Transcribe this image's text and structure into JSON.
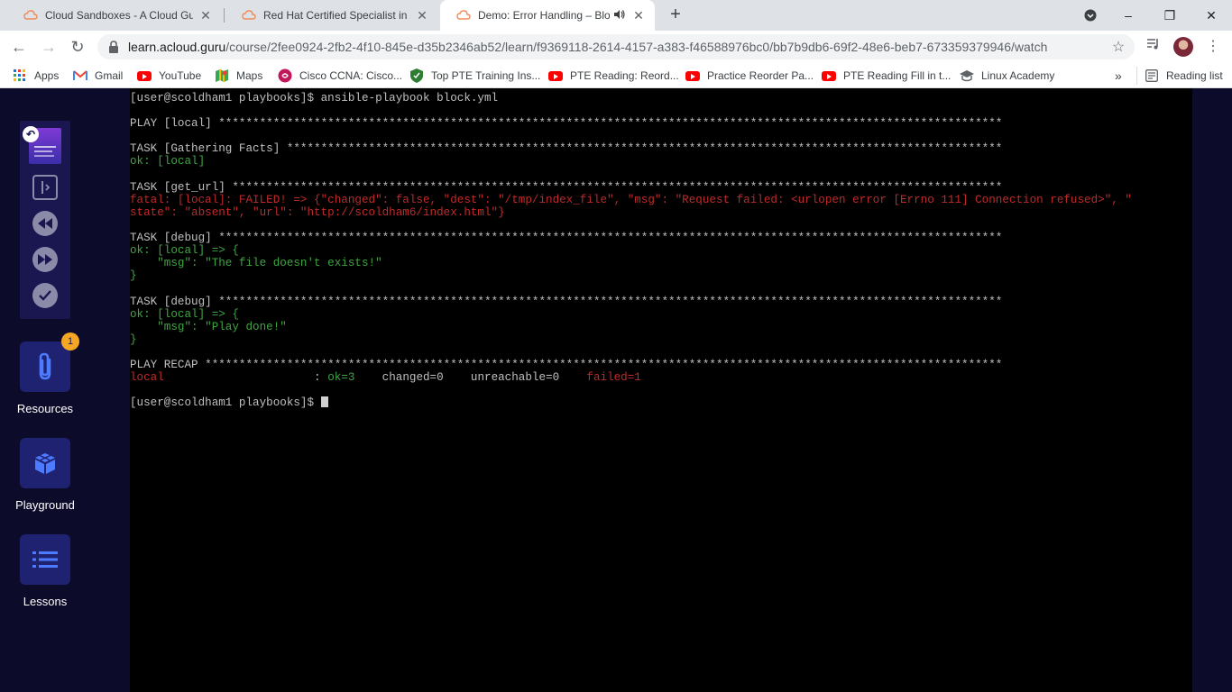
{
  "browser": {
    "tabs": [
      {
        "title": "Cloud Sandboxes - A Cloud Guru",
        "active": false
      },
      {
        "title": "Red Hat Certified Specialist in An",
        "active": false
      },
      {
        "title": "Demo: Error Handling – Block",
        "active": true
      }
    ],
    "new_tab": "+",
    "window_controls": {
      "minimize": "–",
      "restore": "❐",
      "close": "✕"
    },
    "url_host": "learn.acloud.guru",
    "url_path": "/course/2fee0924-2fb2-4f10-845e-d35b2346ab52/learn/f9369118-2614-4157-a383-f46588976bc0/bb7b9db6-69f2-48e6-beb7-673359379946/watch",
    "bookmarks": [
      {
        "label": "Apps",
        "icon": "apps-grid-icon"
      },
      {
        "label": "Gmail",
        "icon": "gmail-icon"
      },
      {
        "label": "YouTube",
        "icon": "youtube-icon"
      },
      {
        "label": "Maps",
        "icon": "maps-icon"
      },
      {
        "label": "Cisco CCNA: Cisco...",
        "icon": "cisco-icon"
      },
      {
        "label": "Top PTE Training Ins...",
        "icon": "shield-icon"
      },
      {
        "label": "PTE Reading: Reord...",
        "icon": "youtube-icon"
      },
      {
        "label": "Practice Reorder Pa...",
        "icon": "youtube-icon"
      },
      {
        "label": "PTE Reading Fill in t...",
        "icon": "youtube-icon"
      },
      {
        "label": "Linux Academy",
        "icon": "graduation-cap-icon"
      }
    ],
    "bookmarks_overflow": "»",
    "reading_list": "Reading list"
  },
  "sidebar": {
    "resources_label": "Resources",
    "resources_badge": "1",
    "playground_label": "Playground",
    "lessons_label": "Lessons"
  },
  "terminal": {
    "lines": [
      {
        "segments": [
          {
            "text": "[user@scoldham1 playbooks]$ ansible-playbook block.yml",
            "color": "w"
          }
        ]
      },
      {
        "segments": [
          {
            "text": " ",
            "color": "w"
          }
        ]
      },
      {
        "segments": [
          {
            "text": "PLAY [local] *******************************************************************************************************************",
            "color": "w"
          }
        ]
      },
      {
        "segments": [
          {
            "text": " ",
            "color": "w"
          }
        ]
      },
      {
        "segments": [
          {
            "text": "TASK [Gathering Facts] *********************************************************************************************************",
            "color": "w"
          }
        ]
      },
      {
        "segments": [
          {
            "text": "ok: [local]",
            "color": "g"
          }
        ]
      },
      {
        "segments": [
          {
            "text": " ",
            "color": "w"
          }
        ]
      },
      {
        "segments": [
          {
            "text": "TASK [get_url] *****************************************************************************************************************",
            "color": "w"
          }
        ]
      },
      {
        "segments": [
          {
            "text": "fatal: [local]: FAILED! => {\"changed\": false, \"dest\": \"/tmp/index_file\", \"msg\": \"Request failed: <urlopen error [Errno 111] Connection refused>\", \"",
            "color": "r"
          }
        ]
      },
      {
        "segments": [
          {
            "text": "state\": \"absent\", \"url\": \"http://scoldham6/index.html\"}",
            "color": "r"
          }
        ]
      },
      {
        "segments": [
          {
            "text": " ",
            "color": "w"
          }
        ]
      },
      {
        "segments": [
          {
            "text": "TASK [debug] *******************************************************************************************************************",
            "color": "w"
          }
        ]
      },
      {
        "segments": [
          {
            "text": "ok: [local] => {",
            "color": "g"
          }
        ]
      },
      {
        "segments": [
          {
            "text": "    \"msg\": \"The file doesn't exists!\"",
            "color": "g"
          }
        ]
      },
      {
        "segments": [
          {
            "text": "}",
            "color": "g"
          }
        ]
      },
      {
        "segments": [
          {
            "text": " ",
            "color": "w"
          }
        ]
      },
      {
        "segments": [
          {
            "text": "TASK [debug] *******************************************************************************************************************",
            "color": "w"
          }
        ]
      },
      {
        "segments": [
          {
            "text": "ok: [local] => {",
            "color": "g"
          }
        ]
      },
      {
        "segments": [
          {
            "text": "    \"msg\": \"Play done!\"",
            "color": "g"
          }
        ]
      },
      {
        "segments": [
          {
            "text": "}",
            "color": "g"
          }
        ]
      },
      {
        "segments": [
          {
            "text": " ",
            "color": "w"
          }
        ]
      },
      {
        "segments": [
          {
            "text": "PLAY RECAP *********************************************************************************************************************",
            "color": "w"
          }
        ]
      },
      {
        "segments": [
          {
            "text": "local",
            "color": "r"
          },
          {
            "text": "                      : ",
            "color": "w"
          },
          {
            "text": "ok=3",
            "color": "g"
          },
          {
            "text": "    changed=0    unreachable=0    ",
            "color": "w"
          },
          {
            "text": "failed=1",
            "color": "r"
          }
        ]
      },
      {
        "segments": [
          {
            "text": " ",
            "color": "w"
          }
        ]
      },
      {
        "segments": [
          {
            "text": "[user@scoldham1 playbooks]$ ",
            "color": "w"
          }
        ],
        "cursor": true
      }
    ]
  },
  "colors": {
    "page_bg": "#0d0b2a",
    "tile_bg": "#1f2270",
    "badge": "#f5a623",
    "term_green": "#3fa63f",
    "term_red": "#c02a2a"
  }
}
